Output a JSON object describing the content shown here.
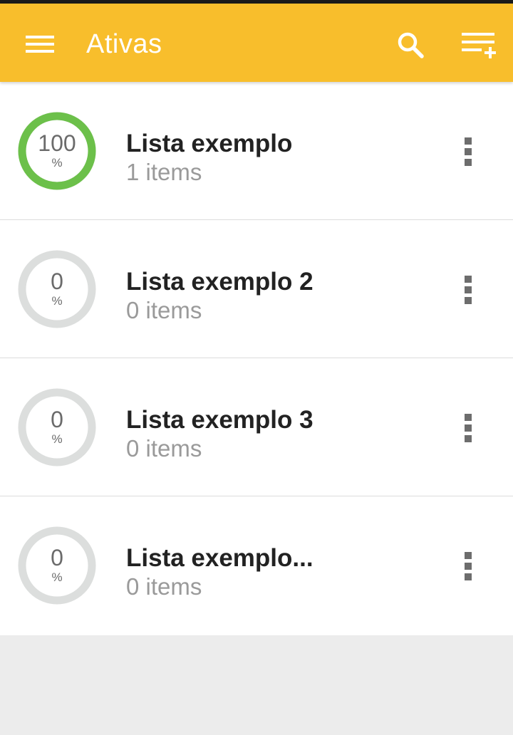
{
  "appbar": {
    "title": "Ativas",
    "icons": [
      "menu-icon",
      "search-icon",
      "playlist-add-icon"
    ],
    "color": "#f8be2c"
  },
  "lists": [
    {
      "name": "Lista exemplo",
      "count": "1 items",
      "percent": "100",
      "percent_sign": "%",
      "progress": 1.0,
      "ring_color": "#6cc04a"
    },
    {
      "name": "Lista exemplo 2",
      "count": "0 items",
      "percent": "0",
      "percent_sign": "%",
      "progress": 0.0,
      "ring_color": "#6cc04a"
    },
    {
      "name": "Lista exemplo 3",
      "count": "0 items",
      "percent": "0",
      "percent_sign": "%",
      "progress": 0.0,
      "ring_color": "#6cc04a"
    },
    {
      "name": "Lista exemplo...",
      "count": "0 items",
      "percent": "0",
      "percent_sign": "%",
      "progress": 0.0,
      "ring_color": "#6cc04a"
    }
  ],
  "colors": {
    "ring_track": "#dcdedd",
    "background": "#ececec"
  }
}
